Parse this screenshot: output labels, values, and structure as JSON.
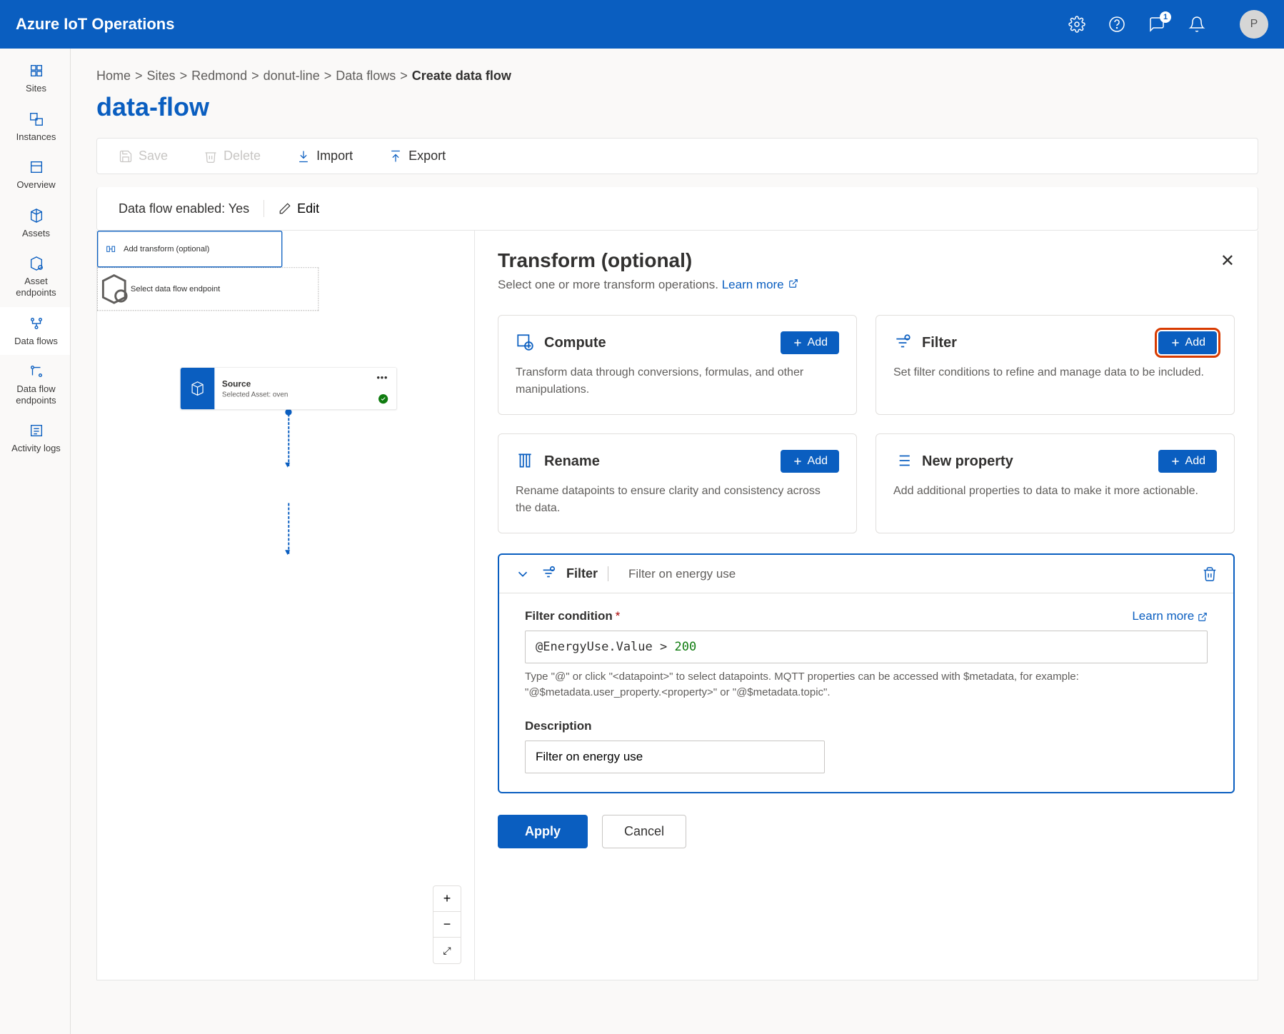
{
  "header": {
    "product": "Azure IoT Operations",
    "feedback_badge": "1",
    "avatar_initial": "P"
  },
  "sidebar": {
    "items": [
      {
        "label": "Sites"
      },
      {
        "label": "Instances"
      },
      {
        "label": "Overview"
      },
      {
        "label": "Assets"
      },
      {
        "label": "Asset endpoints"
      },
      {
        "label": "Data flows"
      },
      {
        "label": "Data flow endpoints"
      },
      {
        "label": "Activity logs"
      }
    ]
  },
  "breadcrumb": {
    "items": [
      "Home",
      "Sites",
      "Redmond",
      "donut-line",
      "Data flows"
    ],
    "current": "Create data flow"
  },
  "page": {
    "title": "data-flow"
  },
  "toolbar": {
    "save": "Save",
    "delete": "Delete",
    "import": "Import",
    "export": "Export"
  },
  "enabled": {
    "label": "Data flow enabled: Yes",
    "edit": "Edit"
  },
  "canvas": {
    "source": {
      "title": "Source",
      "subtitle": "Selected Asset: oven"
    },
    "transform": {
      "title": "Add transform (optional)"
    },
    "endpoint": {
      "title": "Select data flow endpoint"
    }
  },
  "panel": {
    "title": "Transform (optional)",
    "subtitle_pre": "Select one or more transform operations. ",
    "learn_more": "Learn more",
    "cards": {
      "compute": {
        "title": "Compute",
        "desc": "Transform data through conversions, formulas, and other manipulations.",
        "add": "Add"
      },
      "filter": {
        "title": "Filter",
        "desc": "Set filter conditions to refine and manage data to be included.",
        "add": "Add"
      },
      "rename": {
        "title": "Rename",
        "desc": "Rename datapoints to ensure clarity and consistency across the data.",
        "add": "Add"
      },
      "newprop": {
        "title": "New property",
        "desc": "Add additional properties to data to make it more actionable.",
        "add": "Add"
      }
    },
    "editor": {
      "head_name": "Filter",
      "head_sub": "Filter on energy use",
      "cond_label": "Filter condition",
      "cond_value_at": "@EnergyUse.Value",
      "cond_value_op": " > ",
      "cond_value_num": "200",
      "cond_hint": "Type \"@\" or click \"<datapoint>\" to select datapoints. MQTT properties can be accessed with $metadata, for example: \"@$metadata.user_property.<property>\" or \"@$metadata.topic\".",
      "desc_label": "Description",
      "desc_value": "Filter on energy use",
      "learn_more": "Learn more"
    },
    "actions": {
      "apply": "Apply",
      "cancel": "Cancel"
    }
  }
}
